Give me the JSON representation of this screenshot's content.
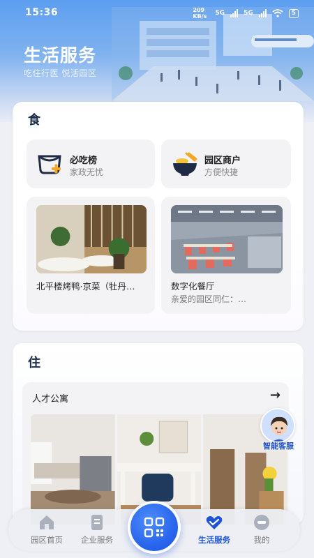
{
  "status_bar": {
    "time": "15:36",
    "net_speed": "209 KB/s",
    "network_1": "5G",
    "network_2": "5G",
    "battery": "5"
  },
  "header": {
    "title": "生活服务",
    "subtitle": "吃住行医 悦活园区"
  },
  "food": {
    "heading": "食",
    "shortcuts": [
      {
        "title": "必吃榜",
        "subtitle": "家政无忧",
        "icon": "bowl-plus-icon"
      },
      {
        "title": "园区商户",
        "subtitle": "方便快捷",
        "icon": "noodle-bowl-icon"
      }
    ],
    "places": [
      {
        "title": "北平楼烤鸭·京菜（牡丹…",
        "subtitle": ""
      },
      {
        "title": "数字化餐厅",
        "subtitle": "亲爱的园区同仁：…"
      }
    ]
  },
  "stay": {
    "heading": "住",
    "apartment_title": "人才公寓",
    "arrow": "→"
  },
  "assistant": {
    "label": "智能客服"
  },
  "nav": {
    "items": [
      {
        "label": "园区首页",
        "icon": "home-icon"
      },
      {
        "label": "企业服务",
        "icon": "document-icon"
      },
      {
        "label": "生活服务",
        "icon": "heart-hands-icon"
      },
      {
        "label": "我的",
        "icon": "profile-icon"
      }
    ],
    "center_icon": "qr-scan-icon",
    "active": "生活服务"
  },
  "colors": {
    "accent": "#1d54d6",
    "hero_top": "#5d9ef0"
  }
}
